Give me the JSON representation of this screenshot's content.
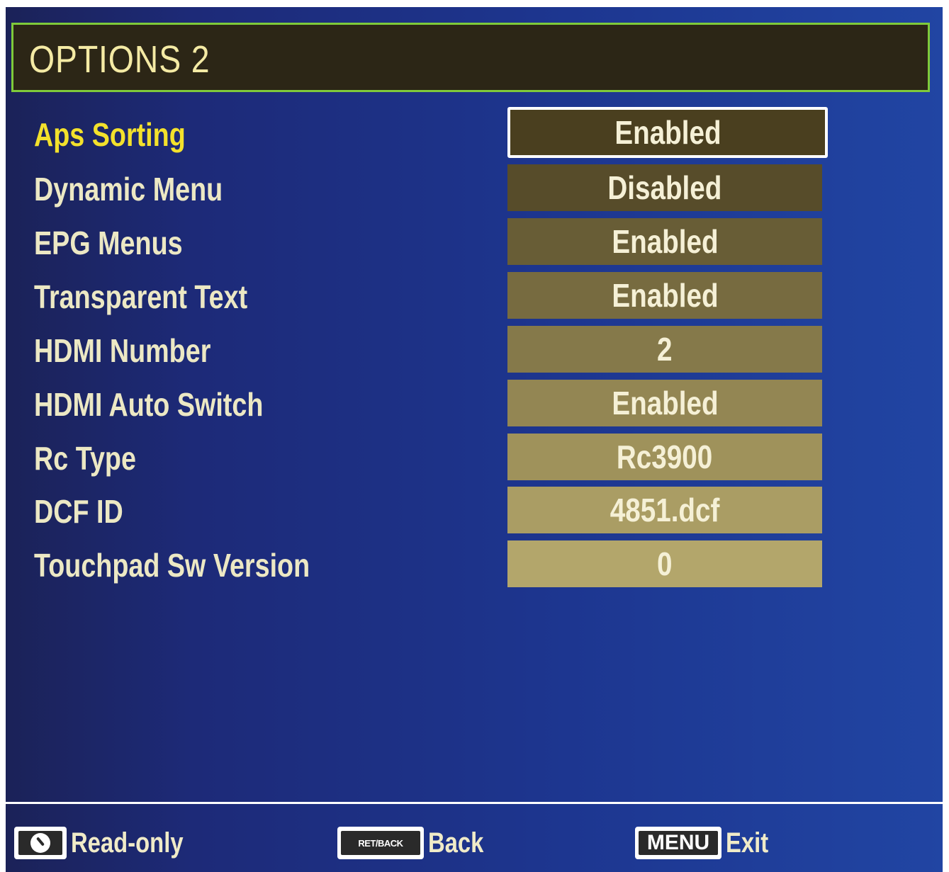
{
  "title": "OPTIONS 2",
  "rows": [
    {
      "label": "Aps Sorting",
      "value": "Enabled",
      "value_color": "#4a3f1f"
    },
    {
      "label": "Dynamic Menu",
      "value": "Disabled",
      "value_color": "#574c2a"
    },
    {
      "label": "EPG Menus",
      "value": "Enabled",
      "value_color": "#685d36"
    },
    {
      "label": "Transparent Text",
      "value": "Enabled",
      "value_color": "#776b40"
    },
    {
      "label": "HDMI Number",
      "value": "2",
      "value_color": "#85794a"
    },
    {
      "label": "HDMI Auto Switch",
      "value": "Enabled",
      "value_color": "#938653"
    },
    {
      "label": "Rc Type",
      "value": "Rc3900",
      "value_color": "#9f925b"
    },
    {
      "label": "DCF ID",
      "value": "4851.dcf",
      "value_color": "#aa9d64"
    },
    {
      "label": "Touchpad Sw Version",
      "value": "0",
      "value_color": "#b3a66b"
    }
  ],
  "selected_index": 0,
  "footer": {
    "readonly": {
      "key_icon": "circle-slash-icon",
      "label": "Read-only"
    },
    "back": {
      "key": "RET/BACK",
      "label": "Back"
    },
    "exit": {
      "key": "MENU",
      "label": "Exit"
    }
  },
  "colors": {
    "title_border": "#7fca3a",
    "selected_label": "#f3e12c",
    "label": "#ece8c4",
    "selected_border": "#ffffff"
  }
}
